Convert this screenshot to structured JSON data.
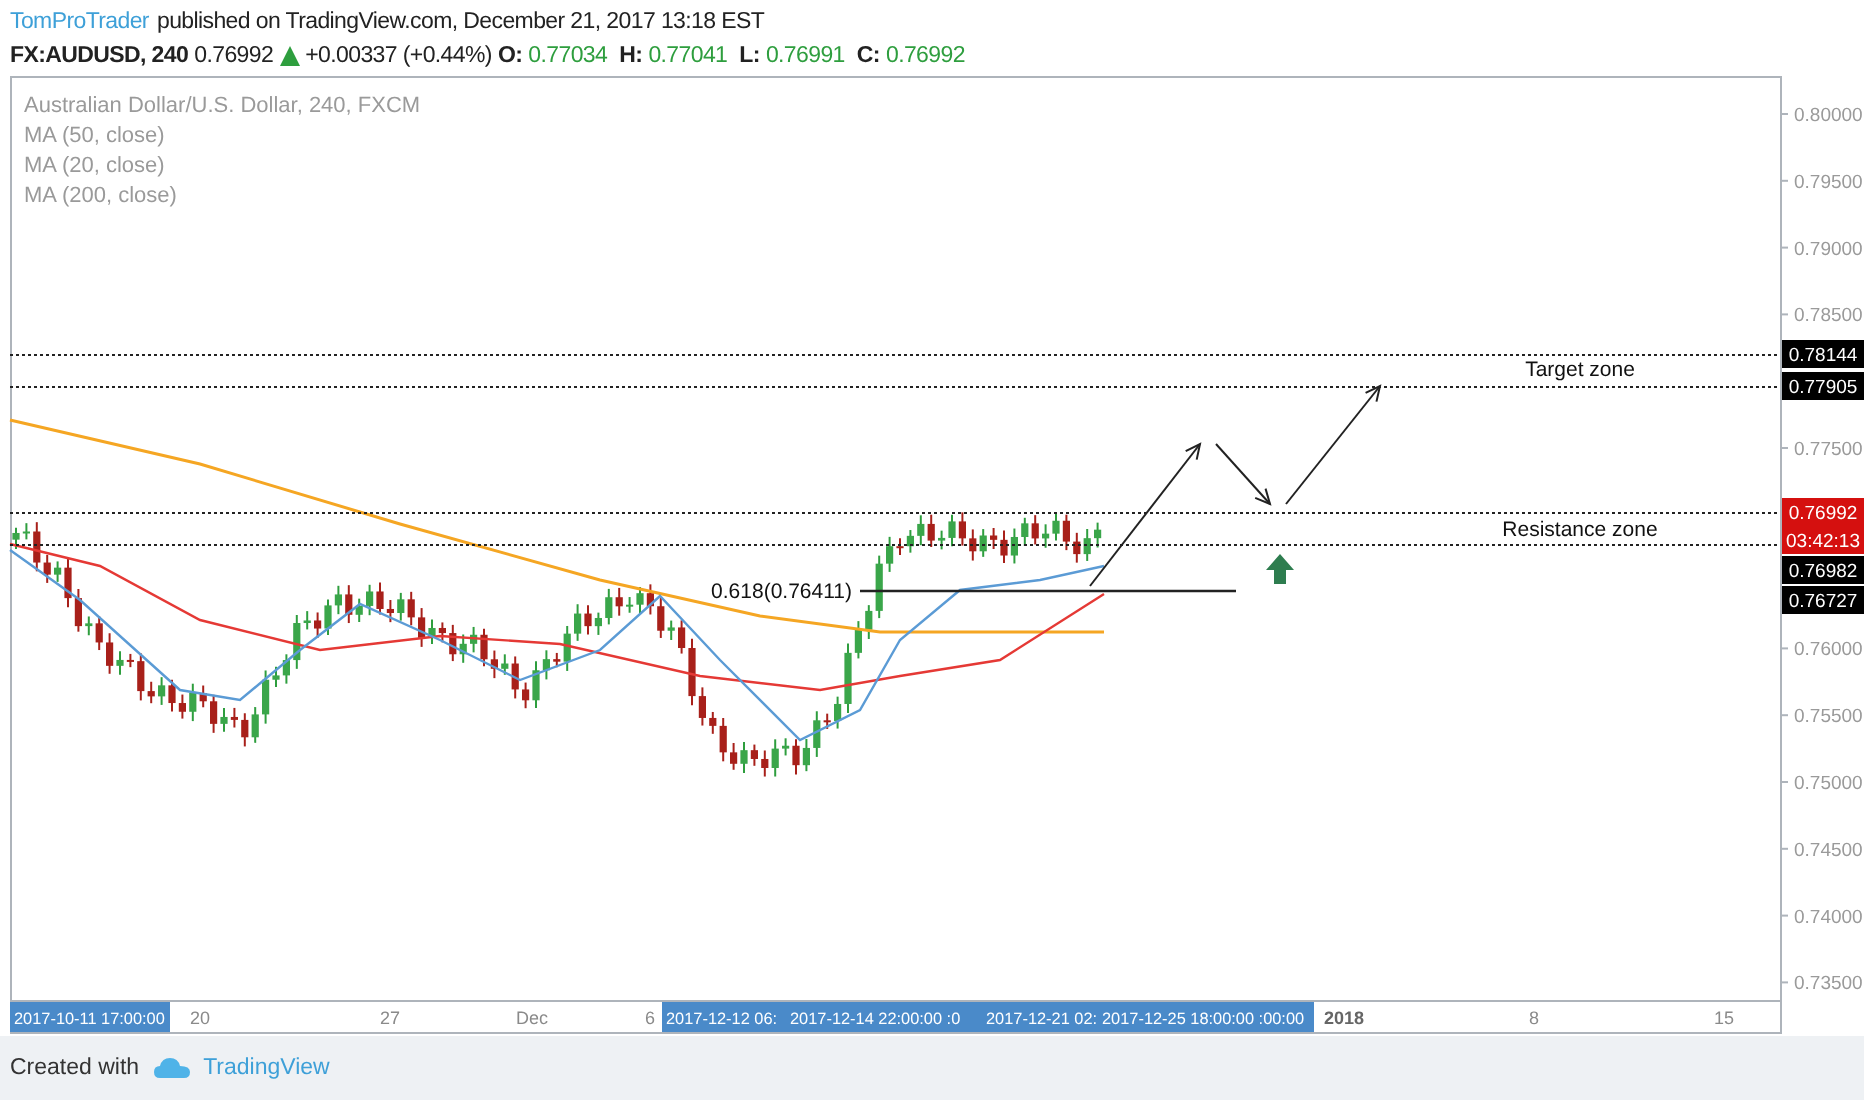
{
  "header": {
    "author": "TomProTrader",
    "published": "published on TradingView.com, December 21, 2017 13:18 EST"
  },
  "quote": {
    "symbol": "FX:AUDUSD, 240",
    "price": "0.76992",
    "rising": true,
    "change": "+0.00337 (+0.44%)",
    "ohlc": [
      {
        "label": "O:",
        "value": "0.77034"
      },
      {
        "label": "H:",
        "value": "0.77041"
      },
      {
        "label": "L:",
        "value": "0.76991"
      },
      {
        "label": "C:",
        "value": "0.76992"
      }
    ]
  },
  "legend": [
    "Australian Dollar/U.S. Dollar, 240, FXCM",
    "MA (50, close)",
    "MA (20, close)",
    "MA (200, close)"
  ],
  "annotations": [
    "Target zone",
    "Resistance zone",
    "0.618(0.76411)"
  ],
  "price_axis": [
    "0.80000",
    "0.79500",
    "0.79000",
    "0.78500",
    "0.77500",
    "0.76000",
    "0.75500",
    "0.75000",
    "0.74500",
    "0.74000",
    "0.73500"
  ],
  "price_badges": [
    {
      "text": "0.78144",
      "color": "#000000"
    },
    {
      "text": "0.77905",
      "color": "#000000"
    },
    {
      "text": "0.76992",
      "color": "#d5100f"
    },
    {
      "text": "03:42:13",
      "color": "#d5100f"
    },
    {
      "text": "0.76982",
      "color": "#000000"
    },
    {
      "text": "0.76727",
      "color": "#000000"
    }
  ],
  "time_axis": [
    {
      "text": "2017-10-11 17:00:00",
      "kind": "cursor"
    },
    {
      "text": "20",
      "kind": "date"
    },
    {
      "text": "27",
      "kind": "date"
    },
    {
      "text": "Dec",
      "kind": "date"
    },
    {
      "text": "6",
      "kind": "date"
    },
    {
      "text": "2017-12-12 06:",
      "kind": "cursor"
    },
    {
      "text": "2017-12-14 22:00:00 :0",
      "kind": "cursor"
    },
    {
      "text": "2017-12-21 02:",
      "kind": "cursor"
    },
    {
      "text": "2017-12-25 18:00:00 :00:00",
      "kind": "cursor"
    },
    {
      "text": "2018",
      "kind": "year"
    },
    {
      "text": "8",
      "kind": "date"
    },
    {
      "text": "15",
      "kind": "date"
    }
  ],
  "footer": {
    "text": "Created with",
    "brand": "TradingView"
  }
}
